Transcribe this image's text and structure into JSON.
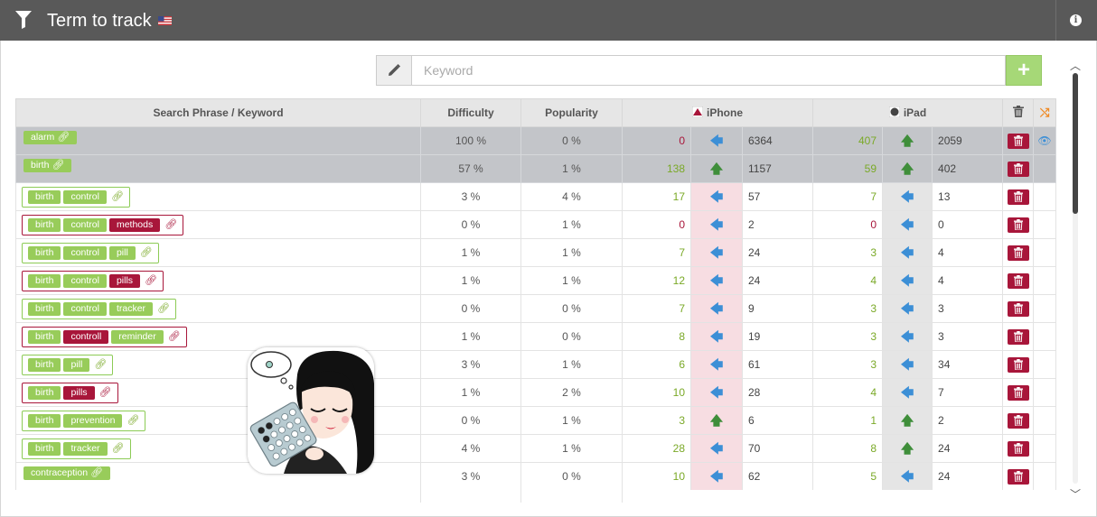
{
  "header": {
    "title": "Term to track",
    "flag_icon": "us-flag-icon",
    "filter_icon": "filter-icon",
    "info_icon": "info-icon"
  },
  "keyword_bar": {
    "placeholder": "Keyword",
    "value": "",
    "add_label": "+"
  },
  "table": {
    "headers": {
      "keyword": "Search Phrase / Keyword",
      "difficulty": "Difficulty",
      "popularity": "Popularity",
      "iphone": "iPhone",
      "ipad": "iPad"
    },
    "rows": [
      {
        "summary": true,
        "bare": true,
        "tags": [
          {
            "text": "alarm",
            "color": "green"
          }
        ],
        "link_color": "white",
        "difficulty": "100 %",
        "popularity": "0 %",
        "iphone_rank": "0",
        "iphone_rank_color": "red",
        "iphone_arrow": "left",
        "iphone_value": "6364",
        "ipad_rank": "407",
        "ipad_rank_color": "green",
        "ipad_arrow": "up",
        "ipad_value": "2059",
        "eye": true
      },
      {
        "summary": true,
        "bare": true,
        "tags": [
          {
            "text": "birth",
            "color": "green"
          }
        ],
        "link_color": "white",
        "difficulty": "57 %",
        "popularity": "1 %",
        "iphone_rank": "138",
        "iphone_rank_color": "green",
        "iphone_arrow": "up",
        "iphone_value": "1157",
        "ipad_rank": "59",
        "ipad_rank_color": "green",
        "ipad_arrow": "up",
        "ipad_value": "402",
        "eye": false
      },
      {
        "summary": false,
        "group_color": "green",
        "tags": [
          {
            "text": "birth",
            "color": "green"
          },
          {
            "text": "control",
            "color": "green"
          }
        ],
        "link_color": "green",
        "difficulty": "3 %",
        "popularity": "4 %",
        "iphone_rank": "17",
        "iphone_rank_color": "green",
        "iphone_arrow": "left",
        "iphone_value": "57",
        "ipad_rank": "7",
        "ipad_rank_color": "green",
        "ipad_arrow": "left",
        "ipad_value": "13"
      },
      {
        "summary": false,
        "group_color": "red",
        "tags": [
          {
            "text": "birth",
            "color": "green"
          },
          {
            "text": "control",
            "color": "green"
          },
          {
            "text": "methods",
            "color": "red"
          }
        ],
        "link_color": "red",
        "difficulty": "0 %",
        "popularity": "1 %",
        "iphone_rank": "0",
        "iphone_rank_color": "red",
        "iphone_arrow": "left",
        "iphone_value": "2",
        "ipad_rank": "0",
        "ipad_rank_color": "red",
        "ipad_arrow": "left",
        "ipad_value": "0"
      },
      {
        "summary": false,
        "group_color": "green",
        "tags": [
          {
            "text": "birth",
            "color": "green"
          },
          {
            "text": "control",
            "color": "green"
          },
          {
            "text": "pill",
            "color": "green"
          }
        ],
        "link_color": "green",
        "difficulty": "1 %",
        "popularity": "1 %",
        "iphone_rank": "7",
        "iphone_rank_color": "green",
        "iphone_arrow": "left",
        "iphone_value": "24",
        "ipad_rank": "3",
        "ipad_rank_color": "green",
        "ipad_arrow": "left",
        "ipad_value": "4"
      },
      {
        "summary": false,
        "group_color": "red",
        "tags": [
          {
            "text": "birth",
            "color": "green"
          },
          {
            "text": "control",
            "color": "green"
          },
          {
            "text": "pills",
            "color": "red"
          }
        ],
        "link_color": "red",
        "difficulty": "1 %",
        "popularity": "1 %",
        "iphone_rank": "12",
        "iphone_rank_color": "green",
        "iphone_arrow": "left",
        "iphone_value": "24",
        "ipad_rank": "4",
        "ipad_rank_color": "green",
        "ipad_arrow": "left",
        "ipad_value": "4"
      },
      {
        "summary": false,
        "group_color": "green",
        "tags": [
          {
            "text": "birth",
            "color": "green"
          },
          {
            "text": "control",
            "color": "green"
          },
          {
            "text": "tracker",
            "color": "green"
          }
        ],
        "link_color": "green",
        "difficulty": "0 %",
        "popularity": "0 %",
        "iphone_rank": "7",
        "iphone_rank_color": "green",
        "iphone_arrow": "left",
        "iphone_value": "9",
        "ipad_rank": "3",
        "ipad_rank_color": "green",
        "ipad_arrow": "left",
        "ipad_value": "3"
      },
      {
        "summary": false,
        "group_color": "red",
        "tags": [
          {
            "text": "birth",
            "color": "green"
          },
          {
            "text": "controll",
            "color": "red"
          },
          {
            "text": "reminder",
            "color": "green"
          }
        ],
        "link_color": "red",
        "difficulty": "1 %",
        "popularity": "0 %",
        "iphone_rank": "8",
        "iphone_rank_color": "green",
        "iphone_arrow": "left",
        "iphone_value": "19",
        "ipad_rank": "3",
        "ipad_rank_color": "green",
        "ipad_arrow": "left",
        "ipad_value": "3"
      },
      {
        "summary": false,
        "group_color": "green",
        "tags": [
          {
            "text": "birth",
            "color": "green"
          },
          {
            "text": "pill",
            "color": "green"
          }
        ],
        "link_color": "green",
        "difficulty": "3 %",
        "popularity": "1 %",
        "iphone_rank": "6",
        "iphone_rank_color": "green",
        "iphone_arrow": "left",
        "iphone_value": "61",
        "ipad_rank": "3",
        "ipad_rank_color": "green",
        "ipad_arrow": "left",
        "ipad_value": "34"
      },
      {
        "summary": false,
        "group_color": "red",
        "tags": [
          {
            "text": "birth",
            "color": "green"
          },
          {
            "text": "pills",
            "color": "red"
          }
        ],
        "link_color": "red",
        "difficulty": "1 %",
        "popularity": "2 %",
        "iphone_rank": "10",
        "iphone_rank_color": "green",
        "iphone_arrow": "left",
        "iphone_value": "28",
        "ipad_rank": "4",
        "ipad_rank_color": "green",
        "ipad_arrow": "left",
        "ipad_value": "7"
      },
      {
        "summary": false,
        "group_color": "green",
        "tags": [
          {
            "text": "birth",
            "color": "green"
          },
          {
            "text": "prevention",
            "color": "green"
          }
        ],
        "link_color": "green",
        "difficulty": "0 %",
        "popularity": "1 %",
        "iphone_rank": "3",
        "iphone_rank_color": "green",
        "iphone_arrow": "up",
        "iphone_value": "6",
        "ipad_rank": "1",
        "ipad_rank_color": "green",
        "ipad_arrow": "up",
        "ipad_value": "2"
      },
      {
        "summary": false,
        "group_color": "green",
        "tags": [
          {
            "text": "birth",
            "color": "green"
          },
          {
            "text": "tracker",
            "color": "green"
          }
        ],
        "link_color": "green",
        "difficulty": "4 %",
        "popularity": "1 %",
        "iphone_rank": "28",
        "iphone_rank_color": "green",
        "iphone_arrow": "left",
        "iphone_value": "70",
        "ipad_rank": "8",
        "ipad_rank_color": "green",
        "ipad_arrow": "up",
        "ipad_value": "24"
      },
      {
        "summary": false,
        "bare": true,
        "tags": [
          {
            "text": "contraception",
            "color": "green"
          }
        ],
        "link_color": "white",
        "difficulty": "3 %",
        "popularity": "0 %",
        "iphone_rank": "10",
        "iphone_rank_color": "green",
        "iphone_arrow": "left",
        "iphone_value": "62",
        "ipad_rank": "5",
        "ipad_rank_color": "green",
        "ipad_arrow": "left",
        "ipad_value": "24"
      }
    ]
  },
  "colors": {
    "header_bg": "#595959",
    "green": "#98cc5a",
    "red": "#a8163a",
    "blue": "#3c8fd6",
    "orange": "#f08a24"
  }
}
